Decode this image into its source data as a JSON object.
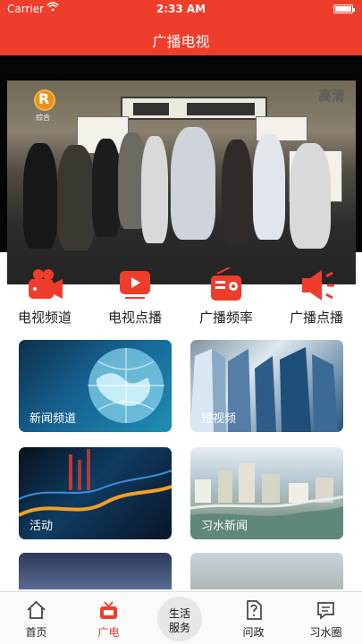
{
  "status": {
    "carrier": "Carrier",
    "time": "2:33 AM"
  },
  "header": {
    "title": "广播电视"
  },
  "player": {
    "overlay_badge": "高清",
    "channel_logo": "综合"
  },
  "quick_actions": [
    {
      "label": "电视频道",
      "icon": "camera-icon"
    },
    {
      "label": "电视点播",
      "icon": "play-icon"
    },
    {
      "label": "广播频率",
      "icon": "radio-icon"
    },
    {
      "label": "广播点播",
      "icon": "speaker-icon"
    }
  ],
  "cards": [
    {
      "label": "新闻频道"
    },
    {
      "label": "短视频"
    },
    {
      "label": "活动"
    },
    {
      "label": "习水新闻"
    }
  ],
  "tabbar": {
    "home": "首页",
    "broadcast": "广电",
    "life_line1": "生活",
    "life_line2": "服务",
    "ask": "问政",
    "circle": "习水圈"
  },
  "colors": {
    "brand": "#ef3d2b",
    "tab_bg": "#fafafa",
    "player_bg": "#050505"
  }
}
